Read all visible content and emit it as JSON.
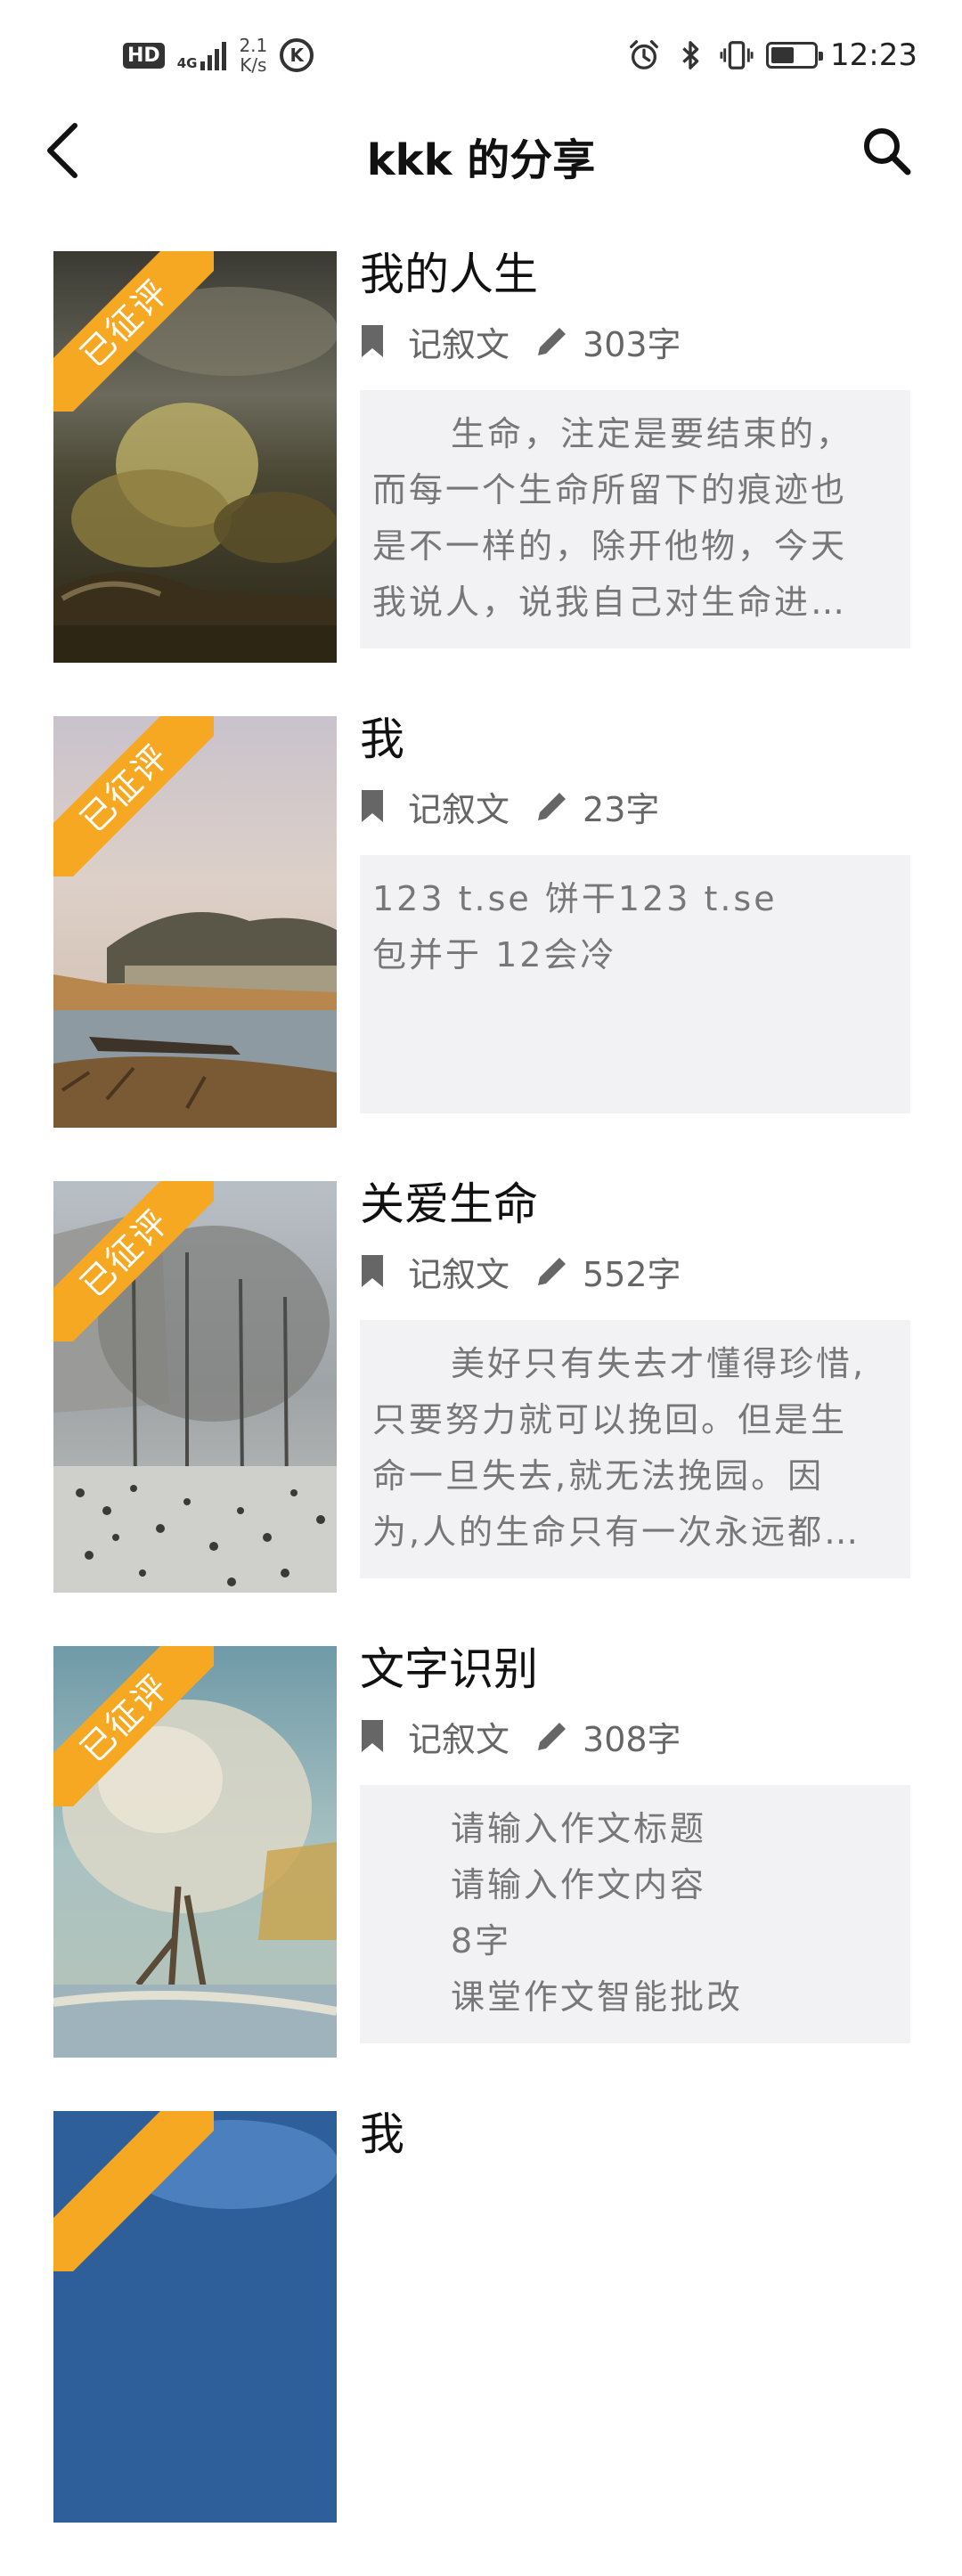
{
  "status_bar": {
    "hd": "HD",
    "network": "4G",
    "speed_value": "2.1",
    "speed_unit": "K/s",
    "k_badge": "K",
    "time": "12:23",
    "battery_level": 0.55
  },
  "nav": {
    "title": "kkk 的分享",
    "back_icon": "chevron-left-icon",
    "search_icon": "search-icon"
  },
  "colors": {
    "ribbon": "#f7a823",
    "excerpt_bg": "#f2f2f4",
    "meta_text": "#666666"
  },
  "items": [
    {
      "badge": "已征评",
      "title": "我的人生",
      "genre": "记叙文",
      "word_count": "303字",
      "excerpt_lines": [
        "生命，注定是要结束的，",
        "而每一个生命所留下的痕迹也",
        "是不一样的，除开他物，今天",
        "我说人，说我自己对生命进…"
      ],
      "first_line_indent": true
    },
    {
      "badge": "已征评",
      "title": "我",
      "genre": "记叙文",
      "word_count": "23字",
      "excerpt_lines": [
        "123 t.se 饼干123 t.se",
        "包并于 12会冷"
      ],
      "first_line_indent": false
    },
    {
      "badge": "已征评",
      "title": "关爱生命",
      "genre": "记叙文",
      "word_count": "552字",
      "excerpt_lines": [
        "美好只有失去才懂得珍惜,",
        "只要努力就可以挽回。但是生",
        "命一旦失去,就无法挽园。因",
        "为,人的生命只有一次永远都…"
      ],
      "first_line_indent": true
    },
    {
      "badge": "已征评",
      "title": "文字识别",
      "genre": "记叙文",
      "word_count": "308字",
      "excerpt_lines": [
        "请输入作文标题",
        "请输入作文内容",
        "8字",
        "课堂作文智能批改"
      ],
      "all_lines_indent": true
    },
    {
      "title": "我"
    }
  ]
}
